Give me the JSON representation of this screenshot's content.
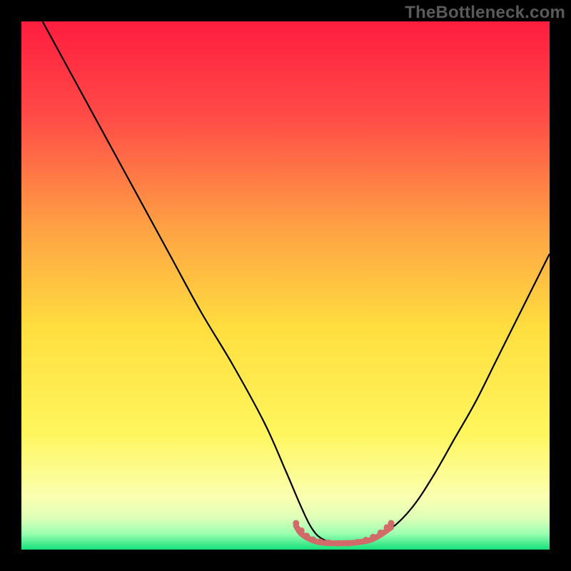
{
  "watermark": "TheBottleneck.com",
  "chart_data": {
    "type": "line",
    "title": "",
    "xlabel": "",
    "ylabel": "",
    "xlim": [
      0,
      100
    ],
    "ylim": [
      0,
      100
    ],
    "background_gradient": {
      "stops": [
        {
          "offset": 0.0,
          "color": "#ff1d3f"
        },
        {
          "offset": 0.18,
          "color": "#ff4b47"
        },
        {
          "offset": 0.4,
          "color": "#ffa544"
        },
        {
          "offset": 0.58,
          "color": "#ffde3f"
        },
        {
          "offset": 0.78,
          "color": "#fff65e"
        },
        {
          "offset": 0.9,
          "color": "#fbffb0"
        },
        {
          "offset": 0.94,
          "color": "#deffb8"
        },
        {
          "offset": 0.97,
          "color": "#9bffb0"
        },
        {
          "offset": 1.0,
          "color": "#14e07a"
        }
      ]
    },
    "series": [
      {
        "name": "curve",
        "stroke": "#000000",
        "stroke_width": 2.2,
        "x": [
          4,
          10,
          16,
          22,
          28,
          34,
          40,
          46,
          50,
          53,
          55,
          57,
          60,
          63,
          66,
          70,
          74,
          78,
          82,
          86,
          90,
          94,
          98,
          100
        ],
        "y": [
          100,
          89,
          78,
          67,
          56,
          45,
          35,
          24,
          15,
          8,
          4,
          2,
          1.2,
          1.2,
          2,
          4,
          8,
          14,
          21,
          28,
          36,
          44,
          52,
          56
        ]
      },
      {
        "name": "valley-highlight",
        "stroke": "#d36a6a",
        "stroke_width": 8,
        "linecap": "round",
        "x": [
          52,
          53,
          55,
          57,
          60,
          63,
          66,
          68,
          70
        ],
        "y": [
          4.5,
          3.0,
          1.8,
          1.3,
          1.2,
          1.3,
          1.8,
          2.8,
          4.2
        ]
      }
    ],
    "valley_dots": {
      "color": "#d36a6a",
      "radius": 4.5,
      "points": [
        {
          "x": 52.0,
          "y": 5.0
        },
        {
          "x": 53.0,
          "y": 3.6
        },
        {
          "x": 54.0,
          "y": 2.6
        },
        {
          "x": 55.2,
          "y": 1.9
        },
        {
          "x": 56.6,
          "y": 1.5
        },
        {
          "x": 58.2,
          "y": 1.3
        },
        {
          "x": 60.0,
          "y": 1.2
        },
        {
          "x": 61.8,
          "y": 1.2
        },
        {
          "x": 63.6,
          "y": 1.4
        },
        {
          "x": 65.2,
          "y": 1.8
        },
        {
          "x": 66.6,
          "y": 2.4
        },
        {
          "x": 68.0,
          "y": 3.2
        },
        {
          "x": 69.2,
          "y": 4.2
        },
        {
          "x": 70.0,
          "y": 5.0
        }
      ]
    }
  }
}
